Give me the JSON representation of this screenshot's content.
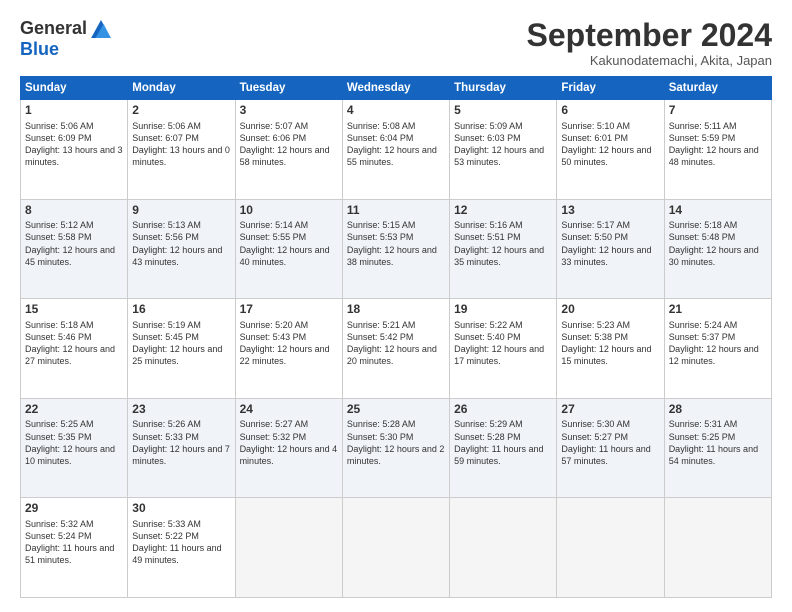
{
  "logo": {
    "general": "General",
    "blue": "Blue"
  },
  "header": {
    "month": "September 2024",
    "location": "Kakunodatemachi, Akita, Japan"
  },
  "weekdays": [
    "Sunday",
    "Monday",
    "Tuesday",
    "Wednesday",
    "Thursday",
    "Friday",
    "Saturday"
  ],
  "weeks": [
    [
      {
        "day": "1",
        "sunrise": "5:06 AM",
        "sunset": "6:09 PM",
        "daylight": "13 hours and 3 minutes."
      },
      {
        "day": "2",
        "sunrise": "5:06 AM",
        "sunset": "6:07 PM",
        "daylight": "13 hours and 0 minutes."
      },
      {
        "day": "3",
        "sunrise": "5:07 AM",
        "sunset": "6:06 PM",
        "daylight": "12 hours and 58 minutes."
      },
      {
        "day": "4",
        "sunrise": "5:08 AM",
        "sunset": "6:04 PM",
        "daylight": "12 hours and 55 minutes."
      },
      {
        "day": "5",
        "sunrise": "5:09 AM",
        "sunset": "6:03 PM",
        "daylight": "12 hours and 53 minutes."
      },
      {
        "day": "6",
        "sunrise": "5:10 AM",
        "sunset": "6:01 PM",
        "daylight": "12 hours and 50 minutes."
      },
      {
        "day": "7",
        "sunrise": "5:11 AM",
        "sunset": "5:59 PM",
        "daylight": "12 hours and 48 minutes."
      }
    ],
    [
      {
        "day": "8",
        "sunrise": "5:12 AM",
        "sunset": "5:58 PM",
        "daylight": "12 hours and 45 minutes."
      },
      {
        "day": "9",
        "sunrise": "5:13 AM",
        "sunset": "5:56 PM",
        "daylight": "12 hours and 43 minutes."
      },
      {
        "day": "10",
        "sunrise": "5:14 AM",
        "sunset": "5:55 PM",
        "daylight": "12 hours and 40 minutes."
      },
      {
        "day": "11",
        "sunrise": "5:15 AM",
        "sunset": "5:53 PM",
        "daylight": "12 hours and 38 minutes."
      },
      {
        "day": "12",
        "sunrise": "5:16 AM",
        "sunset": "5:51 PM",
        "daylight": "12 hours and 35 minutes."
      },
      {
        "day": "13",
        "sunrise": "5:17 AM",
        "sunset": "5:50 PM",
        "daylight": "12 hours and 33 minutes."
      },
      {
        "day": "14",
        "sunrise": "5:18 AM",
        "sunset": "5:48 PM",
        "daylight": "12 hours and 30 minutes."
      }
    ],
    [
      {
        "day": "15",
        "sunrise": "5:18 AM",
        "sunset": "5:46 PM",
        "daylight": "12 hours and 27 minutes."
      },
      {
        "day": "16",
        "sunrise": "5:19 AM",
        "sunset": "5:45 PM",
        "daylight": "12 hours and 25 minutes."
      },
      {
        "day": "17",
        "sunrise": "5:20 AM",
        "sunset": "5:43 PM",
        "daylight": "12 hours and 22 minutes."
      },
      {
        "day": "18",
        "sunrise": "5:21 AM",
        "sunset": "5:42 PM",
        "daylight": "12 hours and 20 minutes."
      },
      {
        "day": "19",
        "sunrise": "5:22 AM",
        "sunset": "5:40 PM",
        "daylight": "12 hours and 17 minutes."
      },
      {
        "day": "20",
        "sunrise": "5:23 AM",
        "sunset": "5:38 PM",
        "daylight": "12 hours and 15 minutes."
      },
      {
        "day": "21",
        "sunrise": "5:24 AM",
        "sunset": "5:37 PM",
        "daylight": "12 hours and 12 minutes."
      }
    ],
    [
      {
        "day": "22",
        "sunrise": "5:25 AM",
        "sunset": "5:35 PM",
        "daylight": "12 hours and 10 minutes."
      },
      {
        "day": "23",
        "sunrise": "5:26 AM",
        "sunset": "5:33 PM",
        "daylight": "12 hours and 7 minutes."
      },
      {
        "day": "24",
        "sunrise": "5:27 AM",
        "sunset": "5:32 PM",
        "daylight": "12 hours and 4 minutes."
      },
      {
        "day": "25",
        "sunrise": "5:28 AM",
        "sunset": "5:30 PM",
        "daylight": "12 hours and 2 minutes."
      },
      {
        "day": "26",
        "sunrise": "5:29 AM",
        "sunset": "5:28 PM",
        "daylight": "11 hours and 59 minutes."
      },
      {
        "day": "27",
        "sunrise": "5:30 AM",
        "sunset": "5:27 PM",
        "daylight": "11 hours and 57 minutes."
      },
      {
        "day": "28",
        "sunrise": "5:31 AM",
        "sunset": "5:25 PM",
        "daylight": "11 hours and 54 minutes."
      }
    ],
    [
      {
        "day": "29",
        "sunrise": "5:32 AM",
        "sunset": "5:24 PM",
        "daylight": "11 hours and 51 minutes."
      },
      {
        "day": "30",
        "sunrise": "5:33 AM",
        "sunset": "5:22 PM",
        "daylight": "11 hours and 49 minutes."
      },
      null,
      null,
      null,
      null,
      null
    ]
  ]
}
